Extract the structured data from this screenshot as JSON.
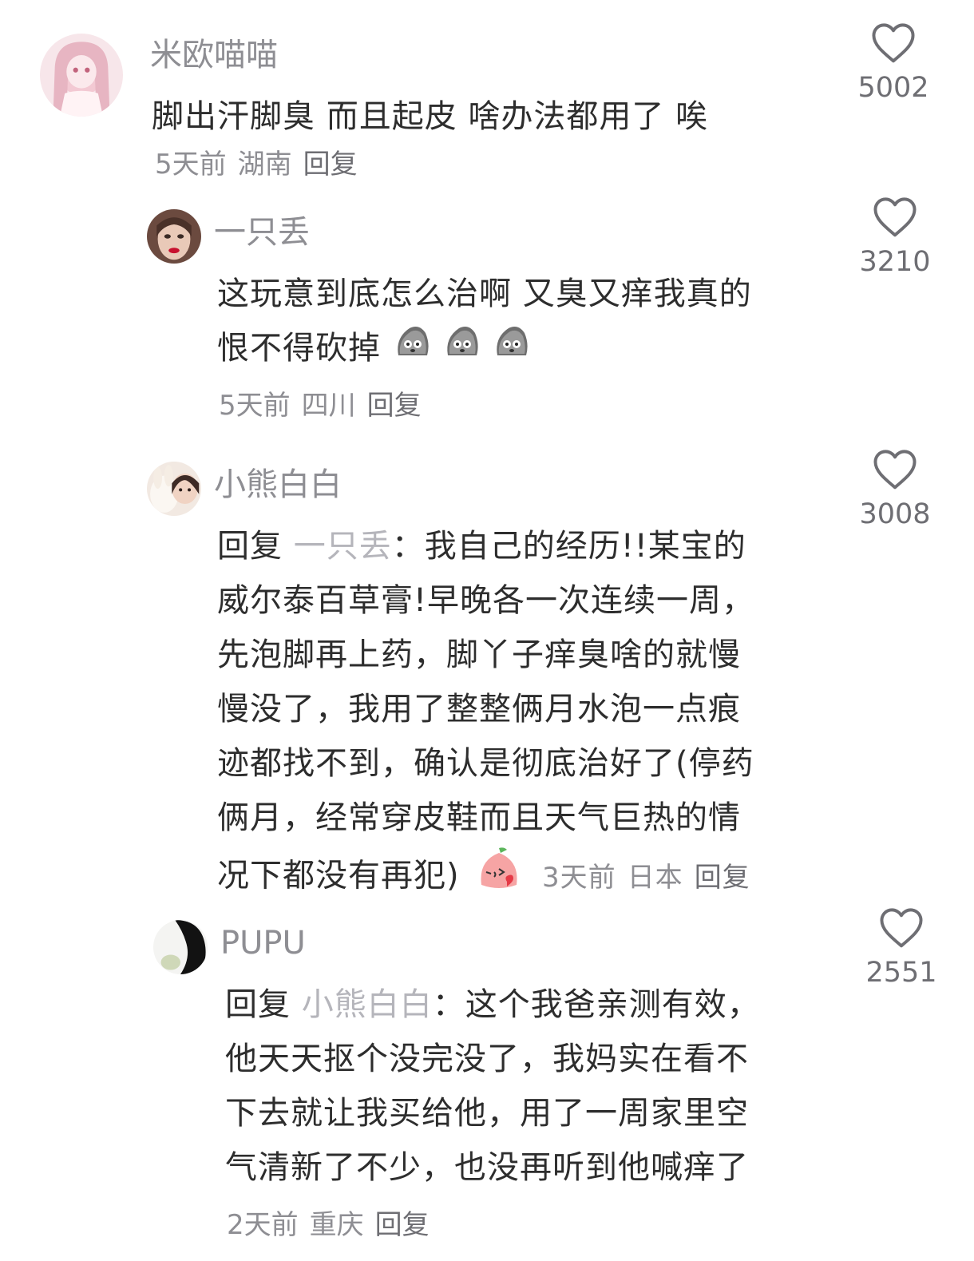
{
  "comments": [
    {
      "username": "米欧喵喵",
      "text": "脚出汗脚臭 而且起皮 啥办法都用了 唉",
      "time": "5天前",
      "location": "湖南",
      "reply_label": "回复",
      "likes": "5002",
      "avatar": "pink-anime-girl-avatar"
    },
    {
      "username": "一只丢",
      "text_line1": "这玩意到底怎么治啊 又臭又痒我真的",
      "text_line2": "恨不得砍掉",
      "emojis": [
        "stone-face-emoji",
        "stone-face-emoji",
        "stone-face-emoji"
      ],
      "time": "5天前",
      "location": "四川",
      "reply_label": "回复",
      "likes": "3210",
      "avatar": "woman-red-lips-avatar"
    },
    {
      "username": "小熊白白",
      "reply_prefix": "回复",
      "reply_target": "一只丢",
      "reply_colon": "：",
      "lines": [
        "我自己的经历!!某宝的",
        "威尔泰百草膏!早晚各一次连续一周，",
        "先泡脚再上药，脚丫子痒臭啥的就慢",
        "慢没了，我用了整整俩月水泡一点痕",
        "迹都找不到，确认是彻底治好了(停药",
        "俩月，经常穿皮鞋而且天气巨热的情",
        "况下都没有再犯)"
      ],
      "emoji": "blowing-kiss-emoji",
      "time": "3天前",
      "location": "日本",
      "reply_label": "回复",
      "likes": "3008",
      "avatar": "girl-with-plush-avatar"
    },
    {
      "username": "PUPU",
      "reply_prefix": "回复",
      "reply_target": "小熊白白",
      "reply_colon": "：",
      "lines": [
        "这个我爸亲测有效，",
        "他天天抠个没完没了，我妈实在看不",
        "下去就让我买给他，用了一周家里空",
        "气清新了不少，也没再听到他喊痒了"
      ],
      "time": "2天前",
      "location": "重庆",
      "reply_label": "回复",
      "likes": "2551",
      "avatar": "dark-hair-avatar"
    }
  ]
}
